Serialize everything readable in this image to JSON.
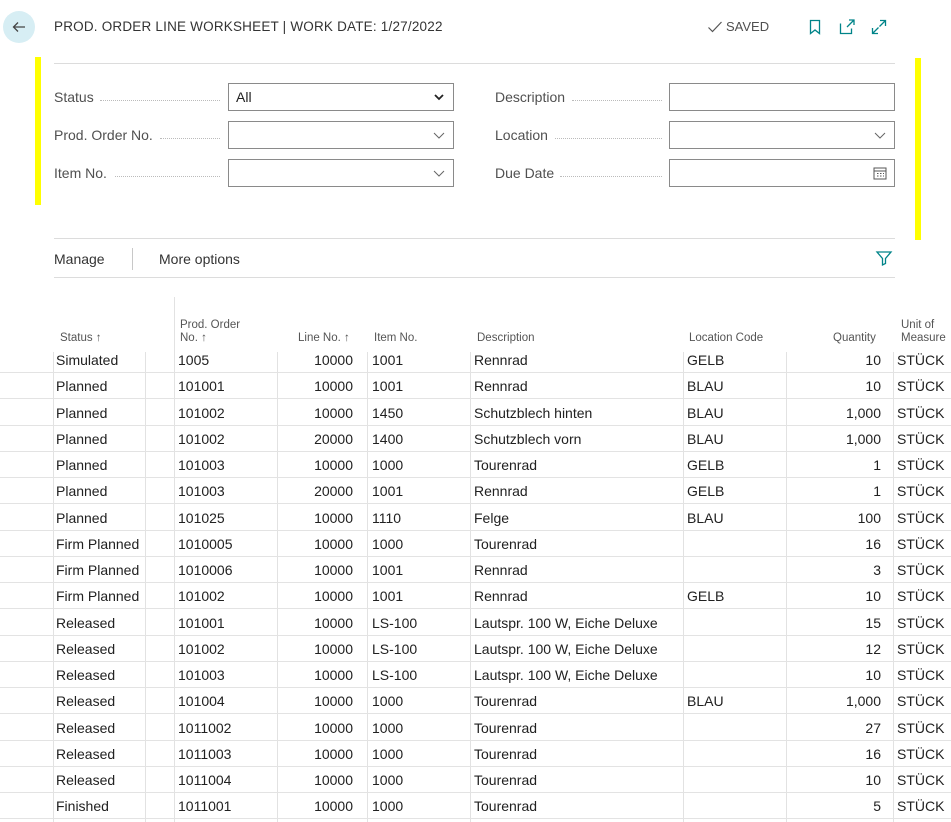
{
  "header": {
    "title": "PROD. ORDER LINE WORKSHEET | WORK DATE: 1/27/2022",
    "saved_label": "SAVED"
  },
  "filters": {
    "status": {
      "label": "Status",
      "value": "All"
    },
    "prod_order_no": {
      "label": "Prod. Order No.",
      "value": ""
    },
    "item_no": {
      "label": "Item No.",
      "value": ""
    },
    "description": {
      "label": "Description",
      "value": ""
    },
    "location": {
      "label": "Location",
      "value": ""
    },
    "due_date": {
      "label": "Due Date",
      "value": ""
    }
  },
  "actions": {
    "manage": "Manage",
    "more_options": "More options"
  },
  "table": {
    "headers": {
      "status": "Status ↑",
      "prod_order_no_line1": "Prod. Order",
      "prod_order_no_line2": "No. ↑",
      "line_no": "Line No. ↑",
      "item_no": "Item No.",
      "description": "Description",
      "location_code": "Location Code",
      "quantity": "Quantity",
      "uom_line1": "Unit of",
      "uom_line2": "Measure"
    },
    "rows": [
      {
        "status": "Simulated",
        "prod_order": "1005",
        "line": "10000",
        "item": "1001",
        "desc": "Rennrad",
        "loc": "GELB",
        "qty": "10",
        "uom": "STÜCK"
      },
      {
        "status": "Planned",
        "prod_order": "101001",
        "line": "10000",
        "item": "1001",
        "desc": "Rennrad",
        "loc": "BLAU",
        "qty": "10",
        "uom": "STÜCK"
      },
      {
        "status": "Planned",
        "prod_order": "101002",
        "line": "10000",
        "item": "1450",
        "desc": "Schutzblech hinten",
        "loc": "BLAU",
        "qty": "1,000",
        "uom": "STÜCK"
      },
      {
        "status": "Planned",
        "prod_order": "101002",
        "line": "20000",
        "item": "1400",
        "desc": "Schutzblech vorn",
        "loc": "BLAU",
        "qty": "1,000",
        "uom": "STÜCK"
      },
      {
        "status": "Planned",
        "prod_order": "101003",
        "line": "10000",
        "item": "1000",
        "desc": "Tourenrad",
        "loc": "GELB",
        "qty": "1",
        "uom": "STÜCK"
      },
      {
        "status": "Planned",
        "prod_order": "101003",
        "line": "20000",
        "item": "1001",
        "desc": "Rennrad",
        "loc": "GELB",
        "qty": "1",
        "uom": "STÜCK"
      },
      {
        "status": "Planned",
        "prod_order": "101025",
        "line": "10000",
        "item": "1110",
        "desc": "Felge",
        "loc": "BLAU",
        "qty": "100",
        "uom": "STÜCK"
      },
      {
        "status": "Firm Planned",
        "prod_order": "1010005",
        "line": "10000",
        "item": "1000",
        "desc": "Tourenrad",
        "loc": "",
        "qty": "16",
        "uom": "STÜCK"
      },
      {
        "status": "Firm Planned",
        "prod_order": "1010006",
        "line": "10000",
        "item": "1001",
        "desc": "Rennrad",
        "loc": "",
        "qty": "3",
        "uom": "STÜCK"
      },
      {
        "status": "Firm Planned",
        "prod_order": "101002",
        "line": "10000",
        "item": "1001",
        "desc": "Rennrad",
        "loc": "GELB",
        "qty": "10",
        "uom": "STÜCK"
      },
      {
        "status": "Released",
        "prod_order": "101001",
        "line": "10000",
        "item": "LS-100",
        "desc": "Lautspr. 100 W, Eiche Deluxe",
        "loc": "",
        "qty": "15",
        "uom": "STÜCK"
      },
      {
        "status": "Released",
        "prod_order": "101002",
        "line": "10000",
        "item": "LS-100",
        "desc": "Lautspr. 100 W, Eiche Deluxe",
        "loc": "",
        "qty": "12",
        "uom": "STÜCK"
      },
      {
        "status": "Released",
        "prod_order": "101003",
        "line": "10000",
        "item": "LS-100",
        "desc": "Lautspr. 100 W, Eiche Deluxe",
        "loc": "",
        "qty": "10",
        "uom": "STÜCK"
      },
      {
        "status": "Released",
        "prod_order": "101004",
        "line": "10000",
        "item": "1000",
        "desc": "Tourenrad",
        "loc": "BLAU",
        "qty": "1,000",
        "uom": "STÜCK"
      },
      {
        "status": "Released",
        "prod_order": "1011002",
        "line": "10000",
        "item": "1000",
        "desc": "Tourenrad",
        "loc": "",
        "qty": "27",
        "uom": "STÜCK"
      },
      {
        "status": "Released",
        "prod_order": "1011003",
        "line": "10000",
        "item": "1000",
        "desc": "Tourenrad",
        "loc": "",
        "qty": "16",
        "uom": "STÜCK"
      },
      {
        "status": "Released",
        "prod_order": "1011004",
        "line": "10000",
        "item": "1000",
        "desc": "Tourenrad",
        "loc": "",
        "qty": "10",
        "uom": "STÜCK"
      },
      {
        "status": "Finished",
        "prod_order": "1011001",
        "line": "10000",
        "item": "1000",
        "desc": "Tourenrad",
        "loc": "",
        "qty": "5",
        "uom": "STÜCK"
      }
    ]
  },
  "colors": {
    "accent": "#008489",
    "highlight_marker": "#ffff00",
    "back_button_bg": "#d7eef4"
  },
  "icons": [
    "back-arrow-icon",
    "checkmark-icon",
    "bookmark-icon",
    "open-in-new-icon",
    "expand-icon",
    "chevron-down-icon",
    "calendar-icon",
    "filter-icon"
  ]
}
